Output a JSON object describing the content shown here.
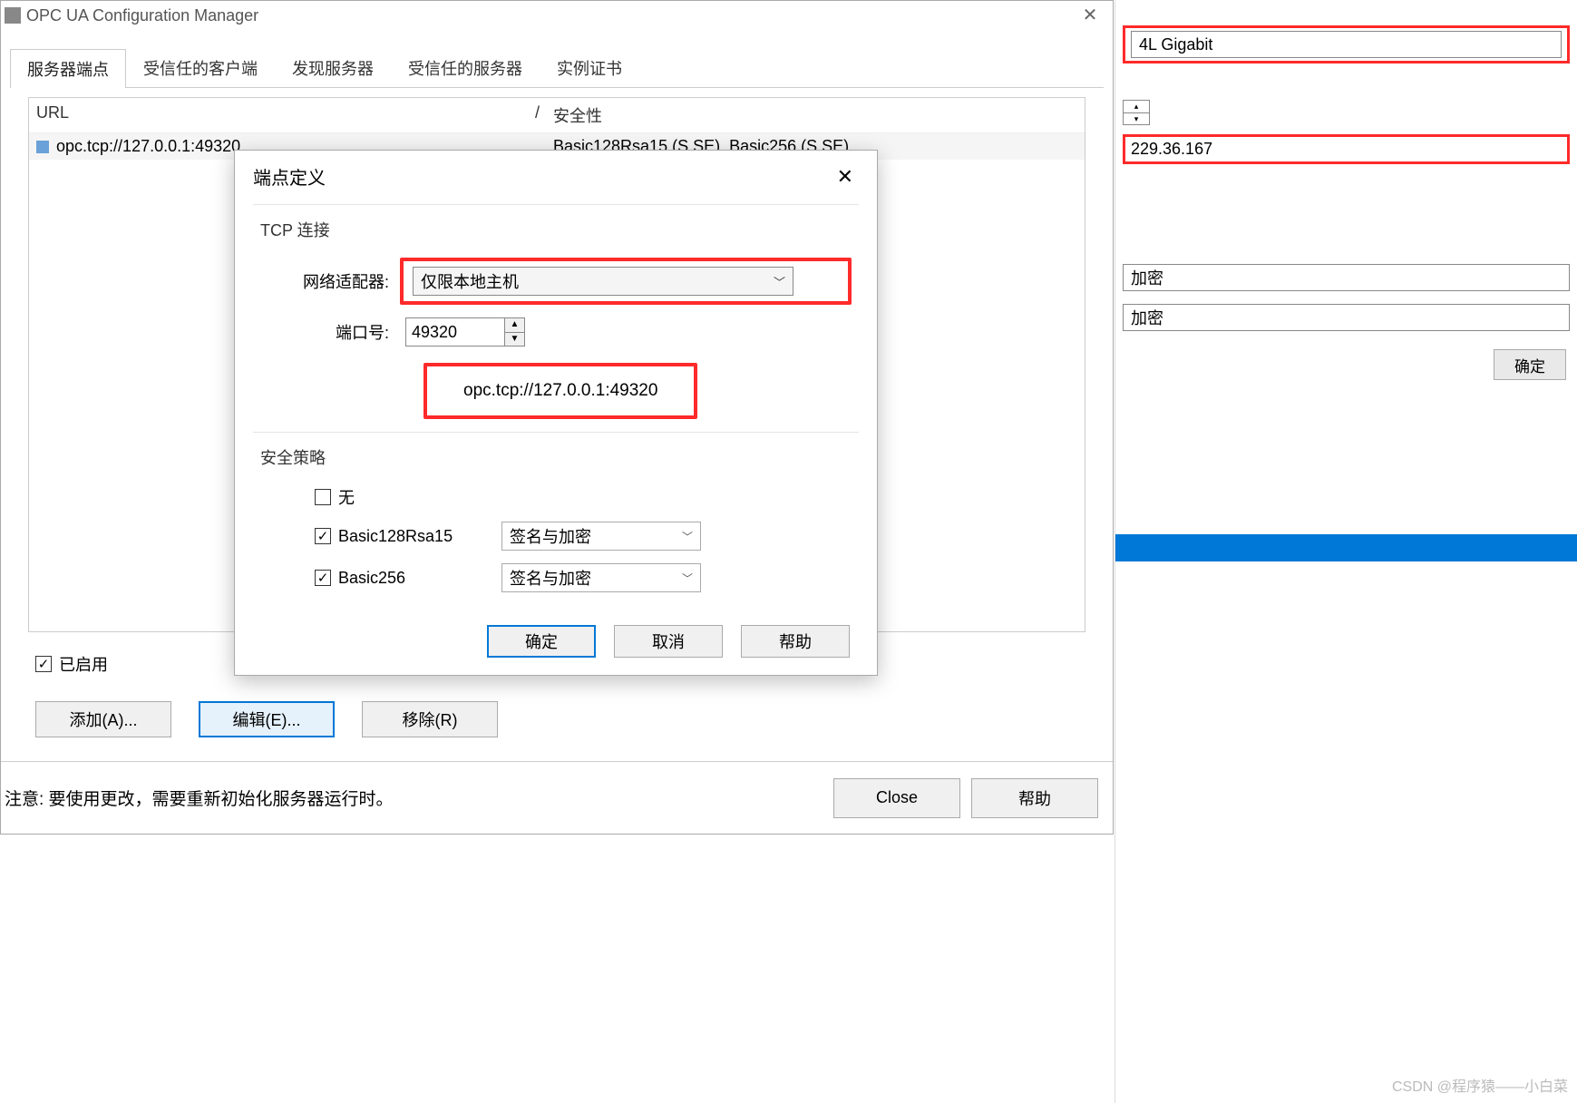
{
  "watermark": "CSDN @程序猿——小白菜",
  "mainWindow": {
    "title": "OPC UA Configuration Manager",
    "tabs": [
      "服务器端点",
      "受信任的客户端",
      "发现服务器",
      "受信任的服务器",
      "实例证书"
    ],
    "activeTab": 0,
    "columns": {
      "url": "URL",
      "sep": "/",
      "security": "安全性"
    },
    "row": {
      "url": "opc.tcp://127.0.0.1:49320",
      "security": "Basic128Rsa15 (S,SE), Basic256 (S,SE)"
    },
    "enabledLabel": "已启用",
    "buttons": {
      "add": "添加(A)...",
      "edit": "编辑(E)...",
      "remove": "移除(R)"
    },
    "footerNote": "注意: 要使用更改，需要重新初始化服务器运行时。",
    "footerButtons": {
      "close": "Close",
      "help": "帮助"
    }
  },
  "modal": {
    "title": "端点定义",
    "sectionTcp": "TCP 连接",
    "adapterLabel": "网络适配器:",
    "adapterValue": "仅限本地主机",
    "portLabel": "端口号:",
    "portValue": "49320",
    "urlDisplay": "opc.tcp://127.0.0.1:49320",
    "sectionPolicy": "安全策略",
    "policies": {
      "none": "无",
      "basic128": "Basic128Rsa15",
      "basic256": "Basic256"
    },
    "signEncrypt": "签名与加密",
    "buttons": {
      "ok": "确定",
      "cancel": "取消",
      "help": "帮助"
    }
  },
  "bgWindow": {
    "nic": "4L Gigabit",
    "ip": "229.36.167",
    "encrypt": "加密",
    "ok": "确定"
  }
}
